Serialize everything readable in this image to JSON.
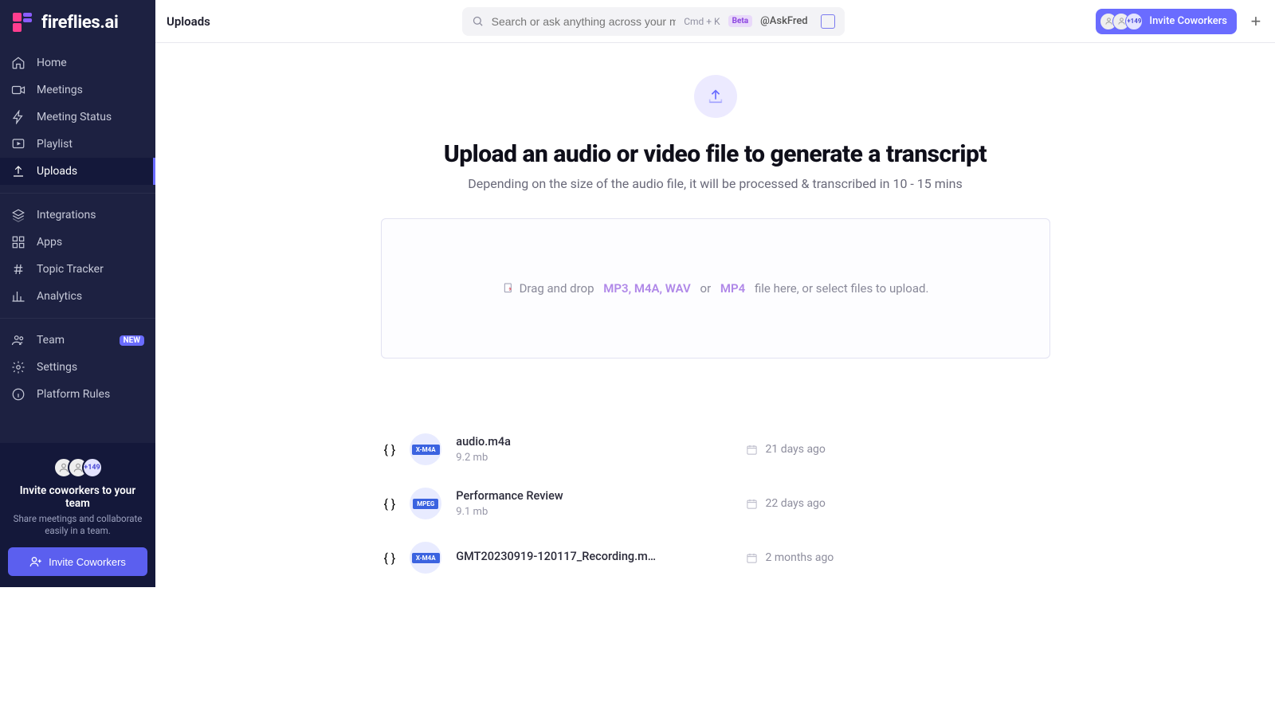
{
  "brand": {
    "name": "fireflies.ai"
  },
  "header": {
    "page_title": "Uploads",
    "search_placeholder": "Search or ask anything across your meetings...",
    "shortcut": "Cmd + K",
    "beta_label": "Beta",
    "ask_fred": "@AskFred",
    "invite_label": "Invite Coworkers",
    "overflow_count": "+149"
  },
  "sidebar": {
    "items": [
      {
        "label": "Home",
        "icon": "home"
      },
      {
        "label": "Meetings",
        "icon": "video"
      },
      {
        "label": "Meeting Status",
        "icon": "bolt"
      },
      {
        "label": "Playlist",
        "icon": "playlist"
      },
      {
        "label": "Uploads",
        "icon": "upload",
        "active": true
      }
    ],
    "items2": [
      {
        "label": "Integrations",
        "icon": "layers"
      },
      {
        "label": "Apps",
        "icon": "grid"
      },
      {
        "label": "Topic Tracker",
        "icon": "hash"
      },
      {
        "label": "Analytics",
        "icon": "bars"
      }
    ],
    "items3": [
      {
        "label": "Team",
        "icon": "team",
        "badge": "NEW"
      },
      {
        "label": "Settings",
        "icon": "gear"
      },
      {
        "label": "Platform Rules",
        "icon": "info"
      }
    ]
  },
  "invite_panel": {
    "title": "Invite coworkers to your team",
    "subtitle": "Share meetings and collaborate easily in a team.",
    "button": "Invite Coworkers",
    "overflow_count": "+149"
  },
  "uploads": {
    "hero_title": "Upload an audio or video file to generate a transcript",
    "hero_subtitle": "Depending on the size of the audio file, it will be processed & transcribed in 10 - 15 mins",
    "drop_pre": "Drag and drop",
    "drop_fmt1": "MP3, M4A, WAV",
    "drop_or": "or",
    "drop_fmt2": "MP4",
    "drop_post": "file here, or select files to upload.",
    "files": [
      {
        "name": "audio.m4a",
        "size": "9.2 mb",
        "date": "21 days ago",
        "badge": "X-M4A"
      },
      {
        "name": "Performance Review",
        "size": "9.1 mb",
        "date": "22 days ago",
        "badge": "MPEG"
      },
      {
        "name": "GMT20230919-120117_Recording.m…",
        "size": "",
        "date": "2 months ago",
        "badge": "X-M4A"
      }
    ]
  }
}
